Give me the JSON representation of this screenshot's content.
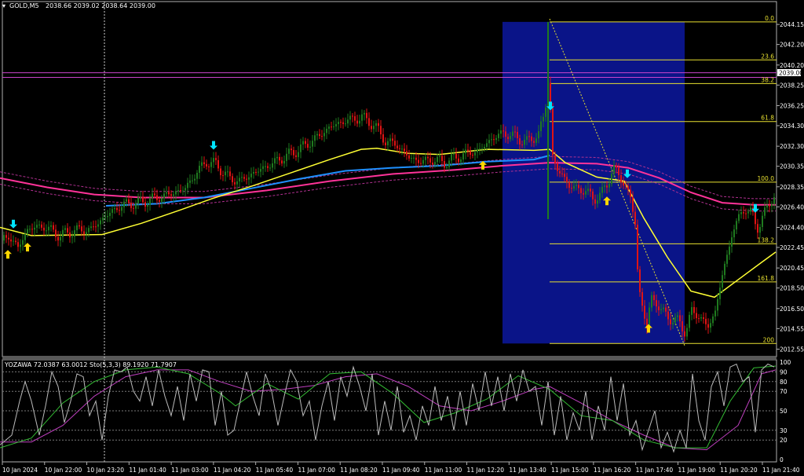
{
  "header": {
    "symbol_timeframe": "GOLD,M5",
    "ohlc": "2038.66 2039.02 2038.64 2039.00"
  },
  "current_price_label": "2039.00",
  "colors": {
    "background": "#000000",
    "bull": "#1f7a1f",
    "bear": "#e01414",
    "ma_fast": "#ffff33",
    "ma_slow": "#1e90ff",
    "ma_long": "#ff3399",
    "envelope": "#b03090",
    "fib_zone": "#0a1488",
    "fib_line": "#e8e030",
    "buy_arrow": "#ffd700",
    "sell_arrow": "#00e5ff",
    "grid": "#7a7a7a",
    "stoch_main": "#bbbbbb",
    "stoch_fast": "#33bb33",
    "stoch_signal": "#c040c0"
  },
  "fib_levels": [
    {
      "label": "0.0",
      "price": 2044.4
    },
    {
      "label": "23.6",
      "price": 2040.7
    },
    {
      "label": "38.2",
      "price": 2038.4
    },
    {
      "label": "61.8",
      "price": 2034.7
    },
    {
      "label": "100.0",
      "price": 2028.8
    },
    {
      "label": "138.2",
      "price": 2022.8
    },
    {
      "label": "161.8",
      "price": 2019.1
    },
    {
      "label": "200",
      "price": 2013.1
    }
  ],
  "subwindow": {
    "title": "YOZAWA 72.0387 63.0012  Sto(5,3,3) 89.1920 71.7907",
    "y_ticks": [
      "100",
      "90",
      "80",
      "70",
      "50",
      "30",
      "20",
      "0"
    ]
  },
  "chart_data": {
    "type": "candlestick",
    "title": "GOLD,M5",
    "ylim": [
      2011.9,
      2046.3
    ],
    "y_ticks": [
      "2044.15",
      "2042.20",
      "2040.20",
      "2038.25",
      "2036.25",
      "2034.30",
      "2032.30",
      "2030.35",
      "2028.35",
      "2026.40",
      "2024.40",
      "2022.45",
      "2020.45",
      "2018.50",
      "2016.50",
      "2014.55",
      "2012.55"
    ],
    "x_ticks": [
      "10 Jan 2024",
      "10 Jan 22:00",
      "10 Jan 23:20",
      "11 Jan 01:40",
      "11 Jan 03:00",
      "11 Jan 04:20",
      "11 Jan 05:40",
      "11 Jan 07:00",
      "11 Jan 08:20",
      "11 Jan 09:40",
      "11 Jan 11:00",
      "11 Jan 12:20",
      "11 Jan 13:40",
      "11 Jan 15:00",
      "11 Jan 16:20",
      "11 Jan 17:40",
      "11 Jan 19:00",
      "11 Jan 20:20",
      "11 Jan 21:40"
    ],
    "price_path": [
      [
        0,
        2023.0
      ],
      [
        10,
        2023.6
      ],
      [
        22,
        2022.4
      ],
      [
        35,
        2024.3
      ],
      [
        55,
        2024.5
      ],
      [
        75,
        2023.6
      ],
      [
        95,
        2024.1
      ],
      [
        115,
        2024.2
      ],
      [
        135,
        2025.6
      ],
      [
        155,
        2026.6
      ],
      [
        175,
        2026.8
      ],
      [
        195,
        2027.2
      ],
      [
        215,
        2027.6
      ],
      [
        235,
        2028.2
      ],
      [
        250,
        2029.8
      ],
      [
        262,
        2030.8
      ],
      [
        275,
        2030.5
      ],
      [
        290,
        2029.2
      ],
      [
        305,
        2028.9
      ],
      [
        320,
        2029.6
      ],
      [
        340,
        2030.4
      ],
      [
        360,
        2031.2
      ],
      [
        380,
        2032.0
      ],
      [
        400,
        2033.0
      ],
      [
        420,
        2034.2
      ],
      [
        440,
        2034.8
      ],
      [
        460,
        2035.1
      ],
      [
        475,
        2034.4
      ],
      [
        490,
        2032.8
      ],
      [
        505,
        2032.4
      ],
      [
        520,
        2031.2
      ],
      [
        535,
        2030.8
      ],
      [
        550,
        2031.0
      ],
      [
        565,
        2030.7
      ],
      [
        580,
        2031.2
      ],
      [
        595,
        2031.6
      ],
      [
        610,
        2031.9
      ],
      [
        625,
        2033.0
      ],
      [
        640,
        2033.6
      ],
      [
        655,
        2033.2
      ],
      [
        670,
        2032.7
      ],
      [
        685,
        2033.5
      ],
      [
        693,
        2035.5
      ],
      [
        697,
        2038.8
      ],
      [
        700,
        2036.0
      ],
      [
        703,
        2031.2
      ],
      [
        708,
        2030.0
      ],
      [
        715,
        2029.6
      ],
      [
        725,
        2028.3
      ],
      [
        735,
        2028.2
      ],
      [
        745,
        2027.9
      ],
      [
        755,
        2027.2
      ],
      [
        765,
        2027.6
      ],
      [
        772,
        2028.6
      ],
      [
        780,
        2030.2
      ],
      [
        788,
        2029.3
      ],
      [
        795,
        2028.6
      ],
      [
        802,
        2027.2
      ],
      [
        808,
        2024.8
      ],
      [
        812,
        2018.8
      ],
      [
        818,
        2016.4
      ],
      [
        823,
        2014.6
      ],
      [
        828,
        2017.6
      ],
      [
        834,
        2017.2
      ],
      [
        840,
        2016.4
      ],
      [
        848,
        2015.8
      ],
      [
        856,
        2015.4
      ],
      [
        864,
        2015.2
      ],
      [
        872,
        2014.2
      ],
      [
        880,
        2016.2
      ],
      [
        890,
        2015.8
      ],
      [
        900,
        2014.6
      ],
      [
        910,
        2016.2
      ],
      [
        918,
        2019.5
      ],
      [
        926,
        2021.8
      ],
      [
        932,
        2024.2
      ],
      [
        940,
        2025.2
      ],
      [
        948,
        2026.4
      ],
      [
        956,
        2025.8
      ],
      [
        963,
        2024.2
      ],
      [
        970,
        2025.5
      ],
      [
        978,
        2026.4
      ],
      [
        985,
        2027.6
      ]
    ],
    "ma_fast_points": [
      [
        0,
        2024.4
      ],
      [
        40,
        2023.6
      ],
      [
        130,
        2023.7
      ],
      [
        180,
        2024.8
      ],
      [
        230,
        2026.1
      ],
      [
        270,
        2027.2
      ],
      [
        320,
        2028.4
      ],
      [
        370,
        2029.7
      ],
      [
        420,
        2031.0
      ],
      [
        460,
        2032.0
      ],
      [
        480,
        2032.1
      ],
      [
        520,
        2031.6
      ],
      [
        560,
        2031.5
      ],
      [
        620,
        2032.0
      ],
      [
        680,
        2031.9
      ],
      [
        700,
        2032.0
      ],
      [
        720,
        2030.7
      ],
      [
        760,
        2029.3
      ],
      [
        795,
        2028.9
      ],
      [
        820,
        2025.3
      ],
      [
        850,
        2021.5
      ],
      [
        880,
        2018.2
      ],
      [
        910,
        2017.6
      ],
      [
        940,
        2019.3
      ],
      [
        970,
        2021.0
      ],
      [
        988,
        2022.0
      ]
    ],
    "ma_slow_points": [
      [
        135,
        2026.5
      ],
      [
        200,
        2026.7
      ],
      [
        260,
        2027.3
      ],
      [
        320,
        2028.2
      ],
      [
        380,
        2029.1
      ],
      [
        440,
        2029.9
      ],
      [
        500,
        2030.2
      ],
      [
        560,
        2030.4
      ],
      [
        620,
        2030.8
      ],
      [
        680,
        2031.0
      ],
      [
        700,
        2031.4
      ]
    ],
    "ma_long_points": [
      [
        0,
        2029.2
      ],
      [
        60,
        2028.3
      ],
      [
        120,
        2027.6
      ],
      [
        180,
        2027.3
      ],
      [
        260,
        2027.3
      ],
      [
        340,
        2028.0
      ],
      [
        420,
        2028.9
      ],
      [
        500,
        2029.6
      ],
      [
        580,
        2030.0
      ],
      [
        640,
        2030.4
      ],
      [
        700,
        2030.7
      ],
      [
        760,
        2030.6
      ],
      [
        800,
        2030.2
      ],
      [
        840,
        2029.2
      ],
      [
        880,
        2027.8
      ],
      [
        920,
        2026.8
      ],
      [
        960,
        2026.6
      ],
      [
        988,
        2026.6
      ]
    ],
    "horizontal_lines": [
      2039.45,
      2039.0
    ],
    "buy_arrow_x": [
      10,
      35,
      615,
      773,
      826
    ],
    "sell_arrow_x": [
      17,
      272,
      701,
      799,
      962
    ],
    "stoch_main": [
      [
        0,
        15
      ],
      [
        15,
        25
      ],
      [
        25,
        60
      ],
      [
        32,
        80
      ],
      [
        40,
        60
      ],
      [
        50,
        25
      ],
      [
        58,
        55
      ],
      [
        66,
        90
      ],
      [
        74,
        75
      ],
      [
        82,
        38
      ],
      [
        90,
        60
      ],
      [
        98,
        88
      ],
      [
        106,
        85
      ],
      [
        114,
        45
      ],
      [
        122,
        60
      ],
      [
        130,
        20
      ],
      [
        138,
        65
      ],
      [
        146,
        92
      ],
      [
        154,
        90
      ],
      [
        162,
        95
      ],
      [
        170,
        70
      ],
      [
        178,
        60
      ],
      [
        186,
        85
      ],
      [
        194,
        55
      ],
      [
        202,
        92
      ],
      [
        210,
        65
      ],
      [
        218,
        45
      ],
      [
        226,
        75
      ],
      [
        234,
        40
      ],
      [
        242,
        88
      ],
      [
        250,
        60
      ],
      [
        258,
        92
      ],
      [
        266,
        90
      ],
      [
        274,
        35
      ],
      [
        282,
        70
      ],
      [
        290,
        25
      ],
      [
        298,
        30
      ],
      [
        306,
        60
      ],
      [
        314,
        90
      ],
      [
        322,
        65
      ],
      [
        330,
        45
      ],
      [
        338,
        88
      ],
      [
        346,
        70
      ],
      [
        354,
        35
      ],
      [
        362,
        65
      ],
      [
        370,
        92
      ],
      [
        378,
        80
      ],
      [
        386,
        45
      ],
      [
        394,
        60
      ],
      [
        402,
        20
      ],
      [
        410,
        55
      ],
      [
        418,
        80
      ],
      [
        426,
        40
      ],
      [
        434,
        85
      ],
      [
        442,
        65
      ],
      [
        450,
        95
      ],
      [
        458,
        75
      ],
      [
        466,
        50
      ],
      [
        474,
        88
      ],
      [
        482,
        25
      ],
      [
        490,
        60
      ],
      [
        498,
        30
      ],
      [
        506,
        75
      ],
      [
        514,
        28
      ],
      [
        522,
        45
      ],
      [
        530,
        20
      ],
      [
        538,
        55
      ],
      [
        546,
        35
      ],
      [
        554,
        75
      ],
      [
        562,
        40
      ],
      [
        570,
        65
      ],
      [
        578,
        30
      ],
      [
        586,
        70
      ],
      [
        594,
        35
      ],
      [
        602,
        78
      ],
      [
        610,
        50
      ],
      [
        618,
        90
      ],
      [
        626,
        55
      ],
      [
        634,
        85
      ],
      [
        642,
        50
      ],
      [
        650,
        88
      ],
      [
        658,
        60
      ],
      [
        666,
        92
      ],
      [
        674,
        70
      ],
      [
        682,
        75
      ],
      [
        690,
        35
      ],
      [
        698,
        80
      ],
      [
        706,
        25
      ],
      [
        714,
        65
      ],
      [
        722,
        20
      ],
      [
        730,
        48
      ],
      [
        738,
        30
      ],
      [
        746,
        70
      ],
      [
        754,
        20
      ],
      [
        762,
        55
      ],
      [
        770,
        30
      ],
      [
        778,
        85
      ],
      [
        786,
        40
      ],
      [
        794,
        78
      ],
      [
        802,
        25
      ],
      [
        810,
        40
      ],
      [
        818,
        10
      ],
      [
        826,
        30
      ],
      [
        834,
        50
      ],
      [
        842,
        12
      ],
      [
        850,
        28
      ],
      [
        858,
        8
      ],
      [
        866,
        30
      ],
      [
        874,
        12
      ],
      [
        882,
        88
      ],
      [
        890,
        40
      ],
      [
        898,
        20
      ],
      [
        906,
        75
      ],
      [
        914,
        90
      ],
      [
        922,
        55
      ],
      [
        930,
        95
      ],
      [
        938,
        98
      ],
      [
        946,
        80
      ],
      [
        954,
        85
      ],
      [
        962,
        28
      ],
      [
        970,
        92
      ],
      [
        978,
        98
      ],
      [
        986,
        95
      ]
    ],
    "stoch_fast": [
      [
        0,
        12
      ],
      [
        40,
        22
      ],
      [
        80,
        58
      ],
      [
        120,
        80
      ],
      [
        160,
        92
      ],
      [
        200,
        95
      ],
      [
        240,
        88
      ],
      [
        280,
        68
      ],
      [
        300,
        55
      ],
      [
        340,
        78
      ],
      [
        380,
        62
      ],
      [
        420,
        88
      ],
      [
        460,
        90
      ],
      [
        500,
        68
      ],
      [
        540,
        38
      ],
      [
        580,
        48
      ],
      [
        620,
        62
      ],
      [
        660,
        86
      ],
      [
        700,
        72
      ],
      [
        740,
        45
      ],
      [
        780,
        40
      ],
      [
        820,
        20
      ],
      [
        860,
        12
      ],
      [
        900,
        12
      ],
      [
        930,
        60
      ],
      [
        960,
        94
      ],
      [
        988,
        96
      ]
    ],
    "stoch_signal": [
      [
        0,
        18
      ],
      [
        40,
        18
      ],
      [
        80,
        35
      ],
      [
        120,
        65
      ],
      [
        160,
        85
      ],
      [
        200,
        92
      ],
      [
        240,
        92
      ],
      [
        280,
        80
      ],
      [
        320,
        70
      ],
      [
        360,
        72
      ],
      [
        400,
        76
      ],
      [
        440,
        85
      ],
      [
        480,
        88
      ],
      [
        520,
        75
      ],
      [
        560,
        55
      ],
      [
        600,
        50
      ],
      [
        640,
        60
      ],
      [
        680,
        72
      ],
      [
        700,
        75
      ],
      [
        740,
        58
      ],
      [
        780,
        40
      ],
      [
        820,
        25
      ],
      [
        860,
        12
      ],
      [
        900,
        10
      ],
      [
        940,
        35
      ],
      [
        970,
        88
      ],
      [
        988,
        92
      ]
    ]
  }
}
